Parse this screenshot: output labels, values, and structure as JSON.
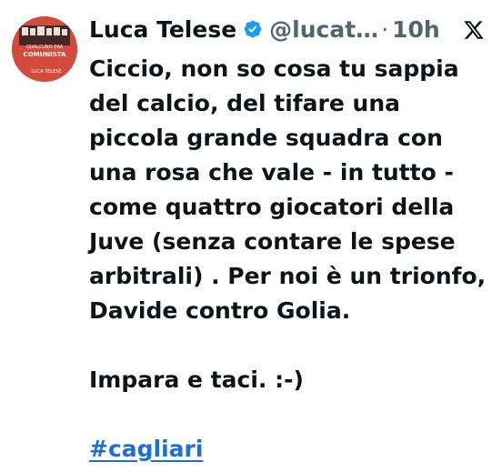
{
  "tweet": {
    "author": {
      "display_name": "Luca Telese",
      "handle": "@lucat…",
      "verified_icon": "verified-badge-icon",
      "avatar_title_small": "QUALCUNO ERA",
      "avatar_title_large": "COMUNISTA",
      "avatar_author": "LUCA TELESE"
    },
    "separator": "·",
    "time": "10h",
    "platform_icon": "x-logo-icon",
    "body_lines": [
      "Ciccio, non so cosa tu sappia",
      "del calcio, del tifare una",
      "piccola grande squadra con",
      "una rosa che vale - in tutto -",
      "come quattro giocatori della",
      "Juve (senza contare le spese",
      "arbitrali) . Per noi è un trionfo,",
      "Davide contro Golia."
    ],
    "closing": "Impara e taci. :-)",
    "hashtag": "#cagliari"
  },
  "colors": {
    "text": "#0f1419",
    "secondary": "#536471",
    "link": "#1d6fd6",
    "verified": "#1d9bf0",
    "avatar_bg": "#d24b3c"
  }
}
